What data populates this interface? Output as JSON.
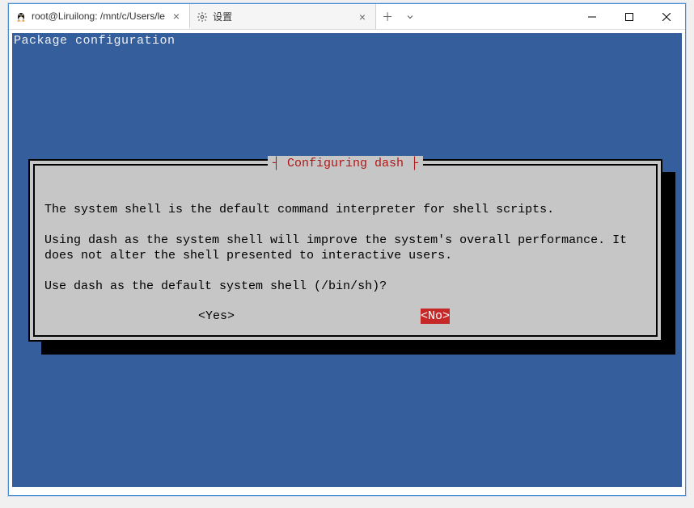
{
  "window": {
    "tab1_label": "root@Liruilong: /mnt/c/Users/le",
    "tab2_label": "设置"
  },
  "terminal": {
    "header": "Package configuration",
    "dialog_title": "Configuring dash",
    "line1": "The system shell is the default command interpreter for shell scripts.",
    "line2": "Using dash as the system shell will improve the system's overall performance. It",
    "line3": "does not alter the shell presented to interactive users.",
    "line4": "Use dash as the default system shell (/bin/sh)?",
    "yes_label": "<Yes>",
    "no_label": "<No>"
  }
}
